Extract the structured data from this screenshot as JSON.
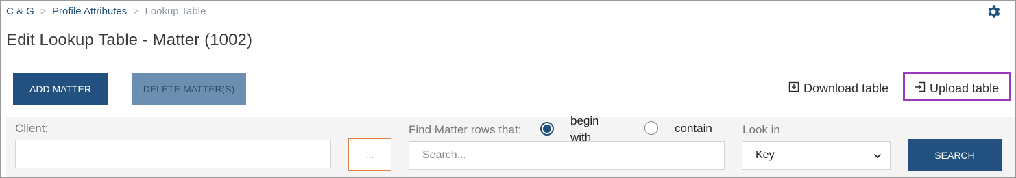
{
  "breadcrumb": {
    "items": [
      "C & G",
      "Profile Attributes"
    ],
    "current": "Lookup Table",
    "separator": ">"
  },
  "header": {
    "title": "Edit Lookup Table - Matter (1002)"
  },
  "toolbar": {
    "add_label": "ADD MATTER",
    "delete_label": "DELETE MATTER(S)",
    "download_label": "Download table",
    "upload_label": "Upload table"
  },
  "filter": {
    "client_label": "Client:",
    "client_value": "",
    "browse_label": "...",
    "find_label": "Find Matter rows that:",
    "options": [
      {
        "label": "begin with",
        "checked": true
      },
      {
        "label": "contain",
        "checked": false
      }
    ],
    "search_placeholder": "Search...",
    "lookin_label": "Look in",
    "lookin_value": "Key",
    "search_button": "SEARCH"
  },
  "colors": {
    "primary": "#22507f",
    "primary_disabled": "#6c8fb1",
    "link": "#1f4e79",
    "highlight": "#9a3bbf",
    "browse_border": "#d9824a"
  },
  "icons": [
    "chevron-right-icon",
    "gear-icon",
    "download-icon",
    "upload-icon",
    "chevron-down-icon"
  ]
}
